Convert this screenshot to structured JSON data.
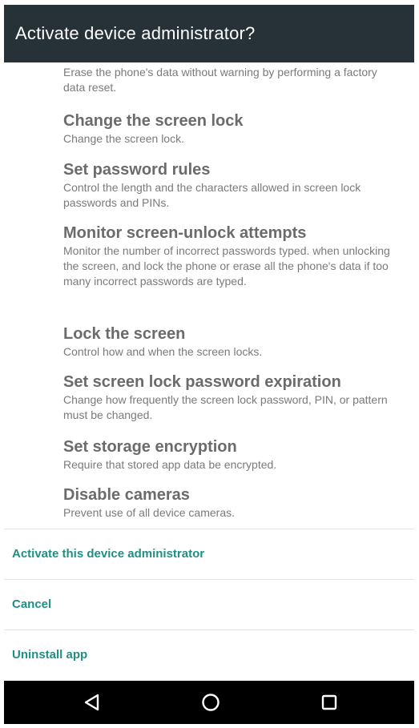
{
  "dialog": {
    "title": "Activate device administrator?"
  },
  "permissions": [
    {
      "title": "",
      "description": "Erase the phone's data without warning by performing a factory data reset."
    },
    {
      "title": "Change the screen lock",
      "description": "Change the screen lock."
    },
    {
      "title": "Set password rules",
      "description": "Control the length and the characters allowed in screen lock passwords and PINs."
    },
    {
      "title": "Monitor screen-unlock attempts",
      "description": "Monitor the number of incorrect passwords typed. when unlocking the screen, and lock the phone or erase all the phone's data if too many incorrect passwords are typed."
    },
    {
      "title": "Lock the screen",
      "description": "Control how and when the screen locks."
    },
    {
      "title": "Set screen lock password expiration",
      "description": "Change how frequently the screen lock password, PIN, or pattern must be changed."
    },
    {
      "title": "Set storage encryption",
      "description": "Require that stored app data be encrypted."
    },
    {
      "title": "Disable cameras",
      "description": "Prevent use of all device cameras."
    }
  ],
  "actions": {
    "activate_label": "Activate this device administrator",
    "cancel_label": "Cancel",
    "uninstall_label": "Uninstall app"
  },
  "navbar": {
    "back_icon": "back-triangle-icon",
    "home_icon": "home-circle-icon",
    "recents_icon": "recents-square-icon"
  },
  "colors": {
    "header_bg": "#263238",
    "accent": "#1f8f86",
    "navbar_bg": "#000000"
  }
}
